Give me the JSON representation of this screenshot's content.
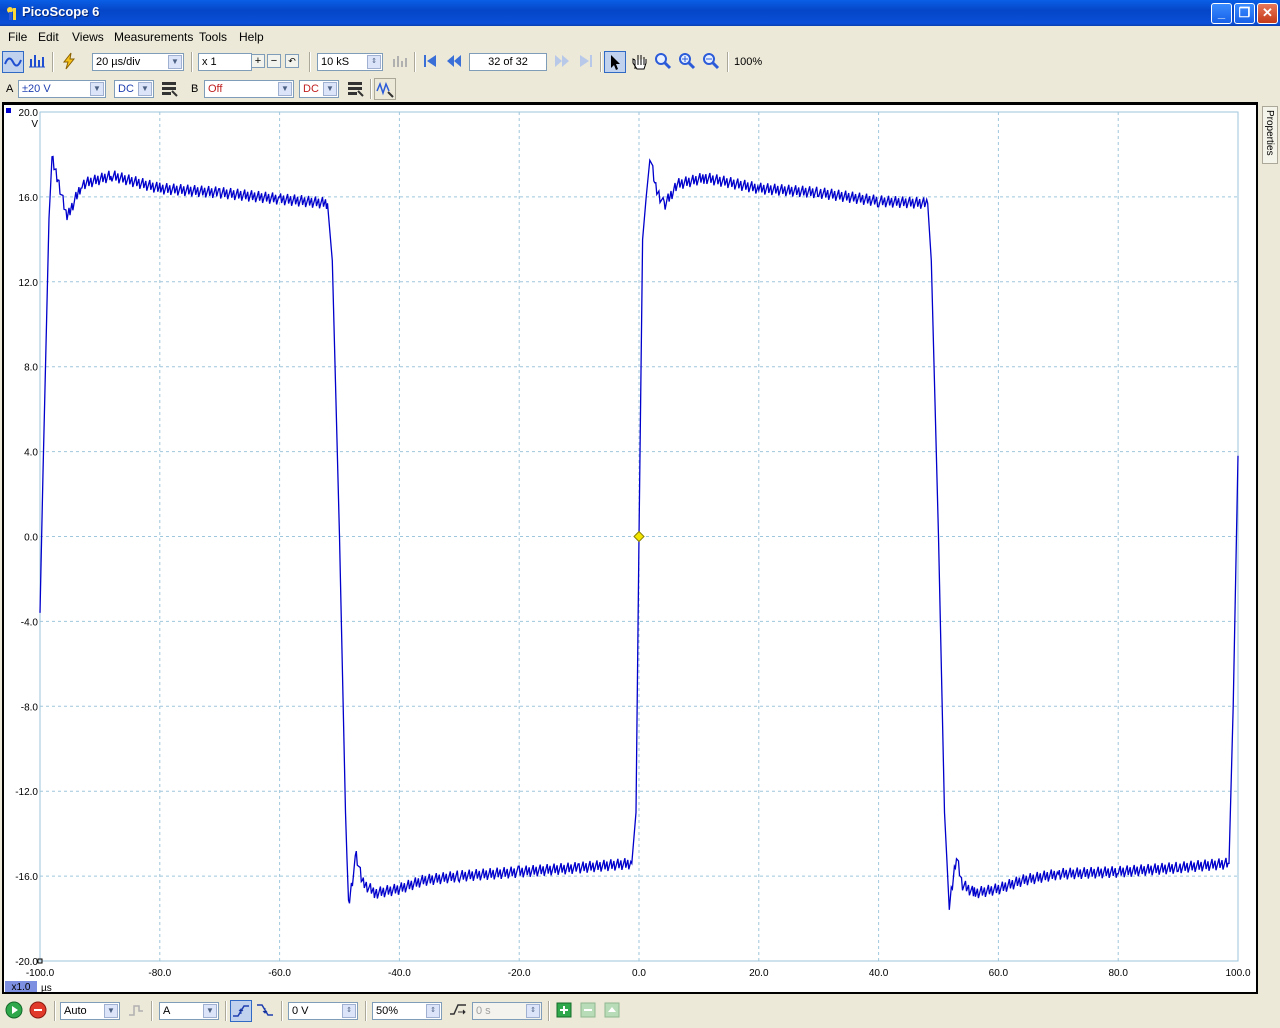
{
  "window": {
    "title": "PicoScope 6",
    "minimize": "_",
    "maximize": "❐",
    "close": "✕"
  },
  "menu": [
    "File",
    "Edit",
    "Views",
    "Measurements",
    "Tools",
    "Help"
  ],
  "toolbar1": {
    "timebase": "20 µs/div",
    "zoom": "x 1",
    "samples": "10 kS",
    "buffer": "32 of 32",
    "zoom_percent": "100%"
  },
  "toolbar2": {
    "channel_a_label": "A",
    "channel_a_range": "±20 V",
    "channel_a_coupling": "DC",
    "channel_b_label": "B",
    "channel_b_range": "Off",
    "channel_b_coupling": "DC"
  },
  "plot": {
    "channel_marker": "A",
    "y_unit": "V",
    "y_top_label": "20.0",
    "x_unit": "µs",
    "x_scale_badge": "x1.0",
    "trace_color": "#0000cc",
    "grid_color": "#9ec6dc",
    "trigger_color": "#f2e600"
  },
  "side_panel": {
    "properties_tab": "Properties"
  },
  "statusbar": {
    "trigger_mode": "Auto",
    "trigger_source": "A",
    "threshold": "0 V",
    "pre_trigger": "50%",
    "delay": "0 s"
  },
  "chart_data": {
    "type": "line",
    "x_label": "µs",
    "y_label": "V",
    "xlim": [
      -100,
      100
    ],
    "ylim": [
      -20,
      20
    ],
    "x_ticks": [
      "-100.0",
      "-80.0",
      "-60.0",
      "-40.0",
      "-20.0",
      "0.0",
      "20.0",
      "40.0",
      "60.0",
      "80.0",
      "100.0"
    ],
    "y_ticks": [
      "20.0",
      "16.0",
      "12.0",
      "8.0",
      "4.0",
      "0.0",
      "-4.0",
      "-8.0",
      "-12.0",
      "-16.0",
      "-20.0"
    ],
    "grid": true,
    "series": [
      {
        "name": "A",
        "x": [
          -100,
          -99.5,
          -98.5,
          -98,
          -97,
          -95.5,
          -93,
          -88,
          -80,
          -70,
          -60,
          -52,
          -51.2,
          -50,
          -49,
          -48.5,
          -47.2,
          -46.2,
          -44,
          -40,
          -36,
          -30,
          -20,
          -10,
          -1.2,
          -0.5,
          0,
          0.6,
          1.8,
          2.8,
          4.2,
          6.5,
          11,
          20,
          30,
          40,
          48.2,
          48.8,
          50,
          51,
          51.8,
          53,
          54,
          56,
          60,
          64,
          70,
          80,
          90,
          98.5,
          99.2,
          100
        ],
        "y": [
          -3.6,
          3,
          15,
          17.8,
          16.8,
          15,
          16.6,
          17,
          16.4,
          16.2,
          15.9,
          15.7,
          13,
          0,
          -13,
          -17.4,
          -15,
          -16.3,
          -16.8,
          -16.6,
          -16.2,
          -16,
          -15.8,
          -15.6,
          -15.4,
          -13,
          0,
          14,
          18,
          16.4,
          15.6,
          16.6,
          16.9,
          16.4,
          16.2,
          15.8,
          15.7,
          13,
          0,
          -13,
          -17.5,
          -15,
          -16.4,
          -16.8,
          -16.6,
          -16.2,
          -15.9,
          -15.8,
          -15.6,
          -15.4,
          -8,
          3.8
        ]
      }
    ],
    "trigger": {
      "x": 0,
      "y": 0
    }
  }
}
